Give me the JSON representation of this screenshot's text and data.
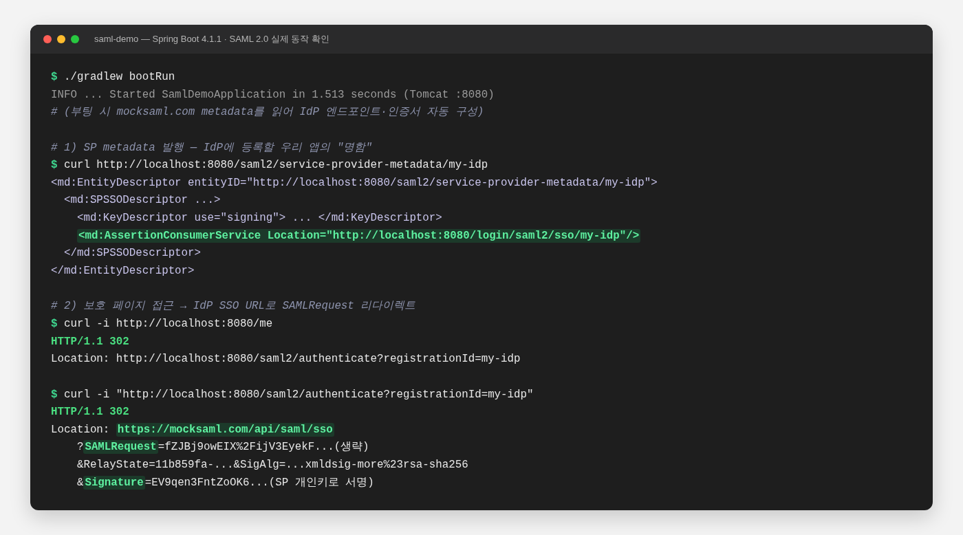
{
  "window": {
    "title": "saml-demo — Spring Boot 4.1.1 · SAML 2.0 실제 동작 확인"
  },
  "lines": [
    {
      "kind": "command",
      "prompt": "$",
      "text": "./gradlew bootRun"
    },
    {
      "kind": "info",
      "parts": [
        {
          "text": "INFO ... Started SamlDemoApplication in 1.513 seconds (Tomcat :8080)",
          "mark": false
        }
      ]
    },
    {
      "kind": "comment",
      "parts": [
        {
          "text": "# (부팅 시 mocksaml.com metadata를 읽어 IdP 엔드포인트·인증서 자동 구성)",
          "mark": false
        }
      ]
    },
    {
      "kind": "blank"
    },
    {
      "kind": "comment",
      "parts": [
        {
          "text": "# 1) SP metadata 발행 — IdP에 등록할 우리 앱의 \"명함\"",
          "mark": false
        }
      ]
    },
    {
      "kind": "command",
      "prompt": "$",
      "text": "curl http://localhost:8080/saml2/service-provider-metadata/my-idp"
    },
    {
      "kind": "xml",
      "parts": [
        {
          "text": "<md:EntityDescriptor entityID=\"http://localhost:8080/saml2/service-provider-metadata/my-idp\">",
          "mark": false
        }
      ]
    },
    {
      "kind": "xml",
      "parts": [
        {
          "text": "  <md:SPSSODescriptor ...>",
          "mark": false
        }
      ]
    },
    {
      "kind": "xml",
      "parts": [
        {
          "text": "    <md:KeyDescriptor use=\"signing\"> ... </md:KeyDescriptor>",
          "mark": false
        }
      ]
    },
    {
      "kind": "xml",
      "parts": [
        {
          "text": "    <md:AssertionConsumerService Location=\"http://localhost:8080/login/saml2/sso/my-idp\"/>",
          "mark": true
        }
      ]
    },
    {
      "kind": "xml",
      "parts": [
        {
          "text": "  </md:SPSSODescriptor>",
          "mark": false
        }
      ]
    },
    {
      "kind": "xml",
      "parts": [
        {
          "text": "</md:EntityDescriptor>",
          "mark": false
        }
      ]
    },
    {
      "kind": "blank"
    },
    {
      "kind": "comment",
      "parts": [
        {
          "text": "# 2) 보호 페이지 접근 → IdP SSO URL로 SAMLRequest 리다이렉트",
          "mark": false
        }
      ]
    },
    {
      "kind": "command",
      "prompt": "$",
      "text": "curl -i http://localhost:8080/me"
    },
    {
      "kind": "status",
      "parts": [
        {
          "text": "HTTP/1.1 302",
          "mark": false
        }
      ]
    },
    {
      "kind": "plain",
      "parts": [
        {
          "text": "Location: http://localhost:8080/saml2/authenticate?registrationId=my-idp",
          "mark": false
        }
      ]
    },
    {
      "kind": "blank"
    },
    {
      "kind": "command",
      "prompt": "$",
      "text": "curl -i \"http://localhost:8080/saml2/authenticate?registrationId=my-idp\""
    },
    {
      "kind": "status",
      "parts": [
        {
          "text": "HTTP/1.1 302",
          "mark": false
        }
      ]
    },
    {
      "kind": "plain",
      "parts": [
        {
          "text": "Location: ",
          "mark": false
        },
        {
          "text": "https://mocksaml.com/api/saml/sso",
          "mark": true
        }
      ]
    },
    {
      "kind": "plain",
      "parts": [
        {
          "text": "    ?",
          "mark": false
        },
        {
          "text": "SAMLRequest",
          "mark": true
        },
        {
          "text": "=fZJBj9owEIX%2FijV3EyekF...(생략)",
          "mark": false
        }
      ]
    },
    {
      "kind": "plain",
      "parts": [
        {
          "text": "    &RelayState=11b859fa-...&SigAlg=...xmldsig-more%23rsa-sha256",
          "mark": false
        }
      ]
    },
    {
      "kind": "plain",
      "parts": [
        {
          "text": "    &",
          "mark": false
        },
        {
          "text": "Signature",
          "mark": true
        },
        {
          "text": "=EV9qen3FntZoOK6...(SP 개인키로 서명)",
          "mark": false
        }
      ]
    }
  ]
}
